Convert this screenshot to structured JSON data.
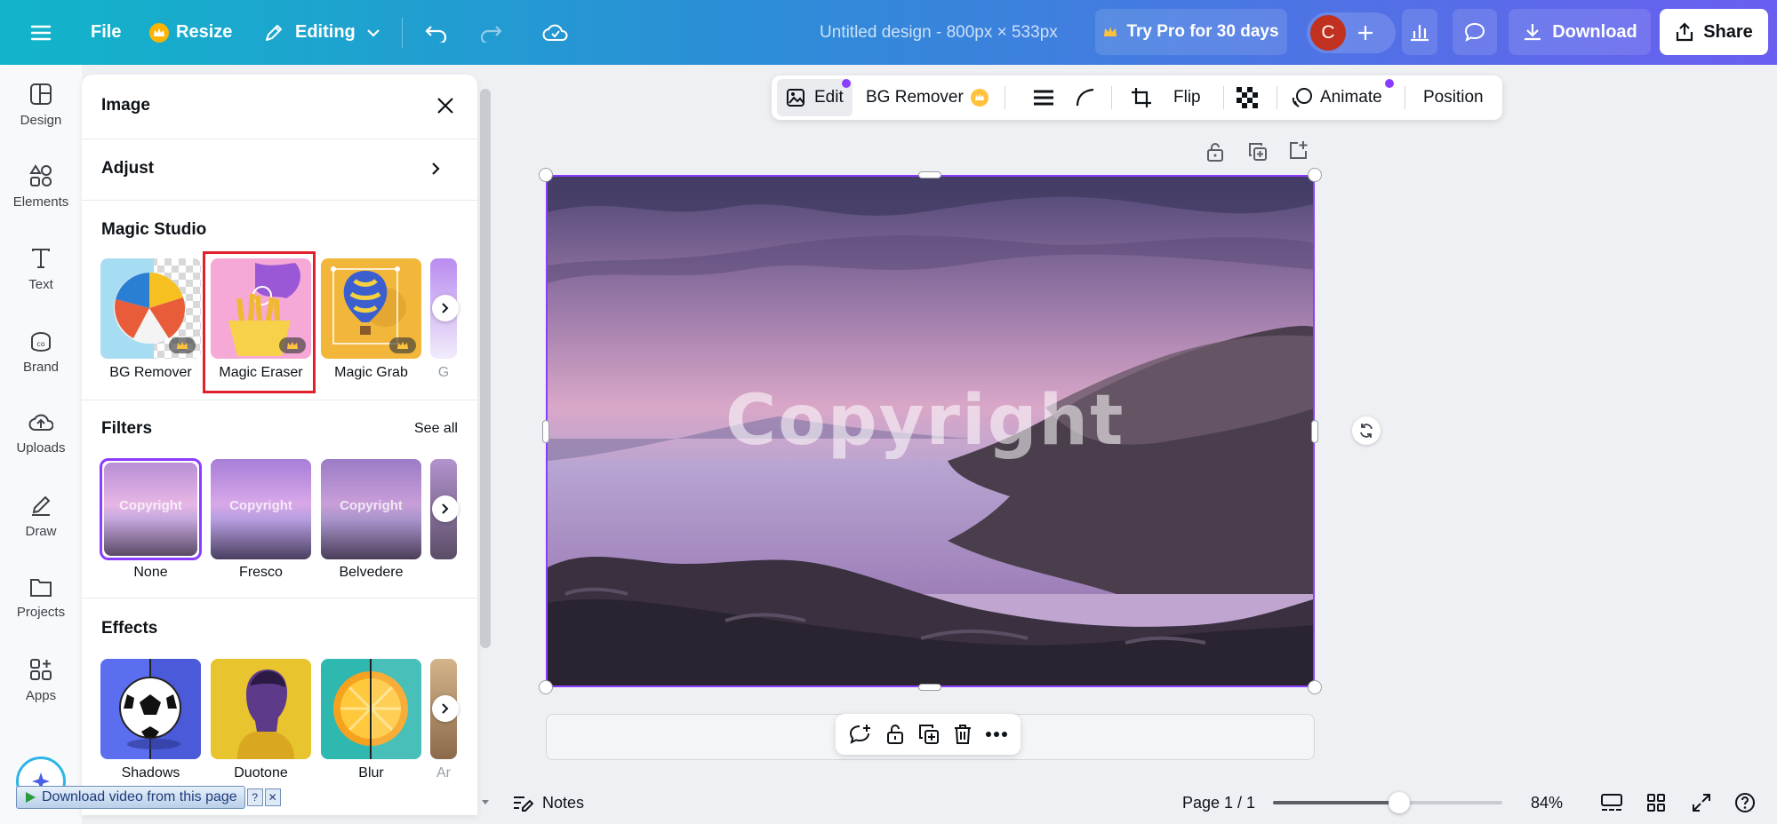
{
  "topbar": {
    "file_label": "File",
    "resize_label": "Resize",
    "editing_label": "Editing",
    "doc_title": "Untitled design - 800px × 533px",
    "try_pro_label": "Try Pro for 30 days",
    "avatar_letter": "C",
    "download_label": "Download",
    "share_label": "Share"
  },
  "left_rail": {
    "items": [
      {
        "label": "Design",
        "icon": "design-icon"
      },
      {
        "label": "Elements",
        "icon": "elements-icon"
      },
      {
        "label": "Text",
        "icon": "text-icon"
      },
      {
        "label": "Brand",
        "icon": "brand-icon"
      },
      {
        "label": "Uploads",
        "icon": "uploads-icon"
      },
      {
        "label": "Draw",
        "icon": "draw-icon"
      },
      {
        "label": "Projects",
        "icon": "projects-icon"
      },
      {
        "label": "Apps",
        "icon": "apps-icon"
      }
    ]
  },
  "panel": {
    "title": "Image",
    "adjust_label": "Adjust",
    "magic_studio_title": "Magic Studio",
    "magic_items": [
      {
        "label": "BG Remover"
      },
      {
        "label": "Magic Eraser"
      },
      {
        "label": "Magic Grab"
      },
      {
        "label": "G"
      }
    ],
    "filters_title": "Filters",
    "see_all_label": "See all",
    "filters": [
      {
        "label": "None",
        "preview_text": "Copyright"
      },
      {
        "label": "Fresco",
        "preview_text": "Copyright"
      },
      {
        "label": "Belvedere",
        "preview_text": "Copyright"
      }
    ],
    "effects_title": "Effects",
    "effects": [
      {
        "label": "Shadows"
      },
      {
        "label": "Duotone"
      },
      {
        "label": "Blur"
      },
      {
        "label": "Ar"
      }
    ]
  },
  "image_toolbar": {
    "edit_label": "Edit",
    "bg_remover_label": "BG Remover",
    "flip_label": "Flip",
    "animate_label": "Animate",
    "position_label": "Position"
  },
  "canvas": {
    "watermark_text": "Copyright"
  },
  "bottom": {
    "notes_label": "Notes",
    "page_label": "Page 1 / 1",
    "zoom_label": "84%",
    "zoom_value": 0.55
  },
  "overlay": {
    "download_video_label": "Download video from this page",
    "help_label": "?",
    "close_label": "✕"
  },
  "colors": {
    "accent": "#8b3dff",
    "highlight": "#e0202a"
  }
}
